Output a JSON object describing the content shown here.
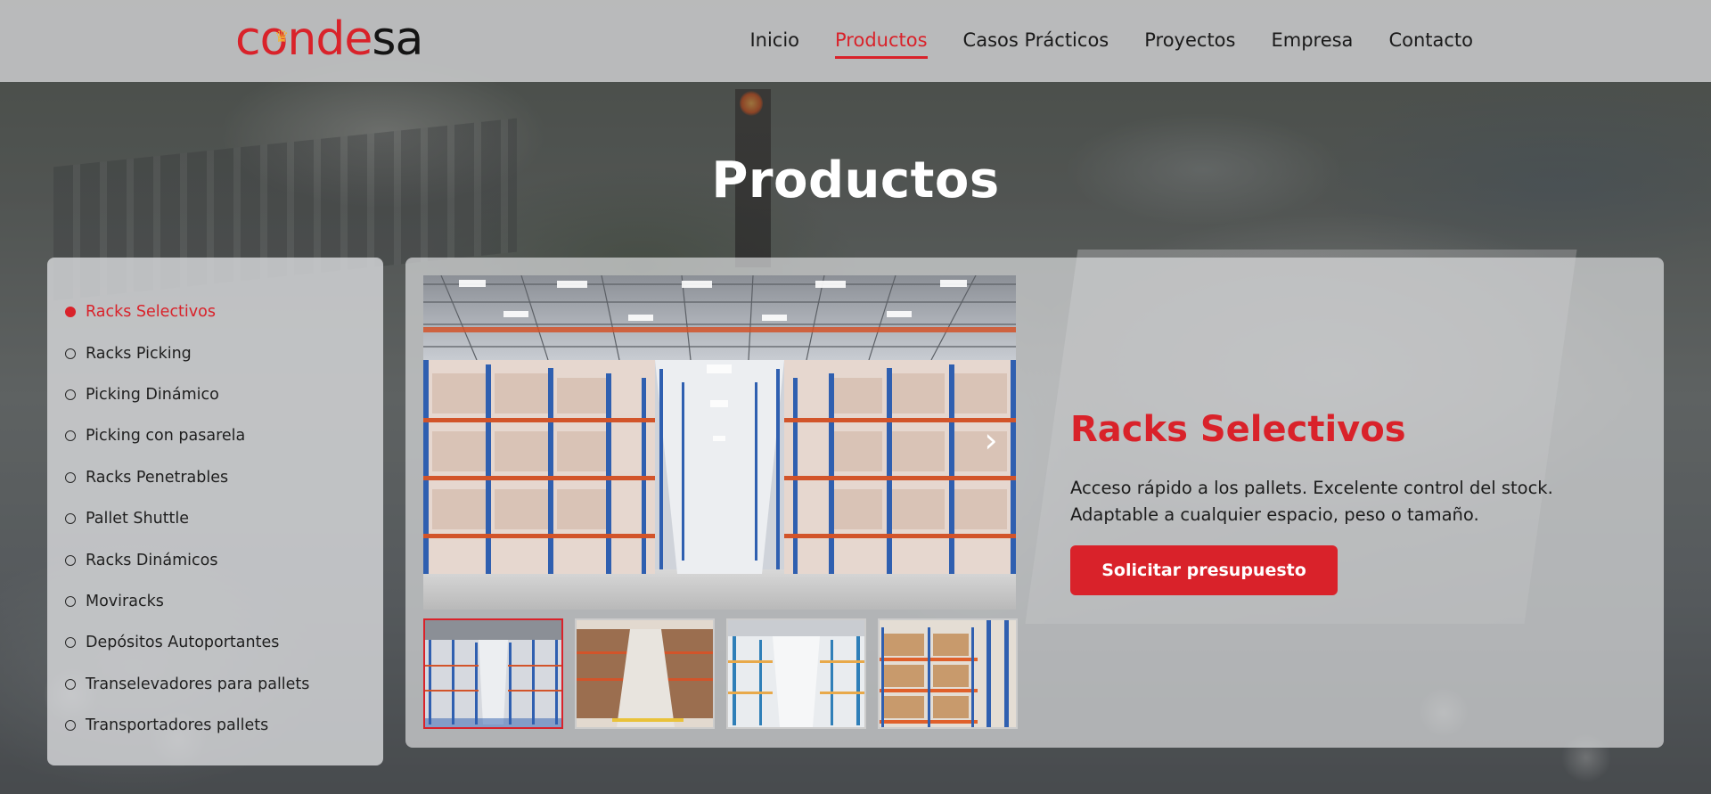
{
  "header": {
    "logo": {
      "part1": "cond",
      "part2": "e",
      "part3": "sa"
    },
    "nav": [
      {
        "label": "Inicio",
        "active": false
      },
      {
        "label": "Productos",
        "active": true
      },
      {
        "label": "Casos Prácticos",
        "active": false
      },
      {
        "label": "Proyectos",
        "active": false
      },
      {
        "label": "Empresa",
        "active": false
      },
      {
        "label": "Contacto",
        "active": false
      }
    ]
  },
  "page": {
    "title": "Productos"
  },
  "sidebar": {
    "items": [
      {
        "label": "Racks Selectivos",
        "active": true
      },
      {
        "label": "Racks Picking",
        "active": false
      },
      {
        "label": "Picking Dinámico",
        "active": false
      },
      {
        "label": "Picking con pasarela",
        "active": false
      },
      {
        "label": "Racks Penetrables",
        "active": false
      },
      {
        "label": "Pallet Shuttle",
        "active": false
      },
      {
        "label": "Racks Dinámicos",
        "active": false
      },
      {
        "label": "Moviracks",
        "active": false
      },
      {
        "label": "Depósitos Autoportantes",
        "active": false
      },
      {
        "label": "Transelevadores para pallets",
        "active": false
      },
      {
        "label": "Transportadores pallets",
        "active": false
      }
    ]
  },
  "product": {
    "title": "Racks Selectivos",
    "description_line1": "Acceso rápido a los pallets. Excelente control del stock.",
    "description_line2": "Adaptable a cualquier espacio, peso o tamaño.",
    "cta_label": "Solicitar presupuesto",
    "next_icon": "chevron-right-icon",
    "thumbnail_count": 4,
    "active_thumbnail": 1
  },
  "colors": {
    "brand_red": "#d9222a",
    "rack_blue": "#2f5fb0",
    "beam_orange": "#d2542a"
  }
}
